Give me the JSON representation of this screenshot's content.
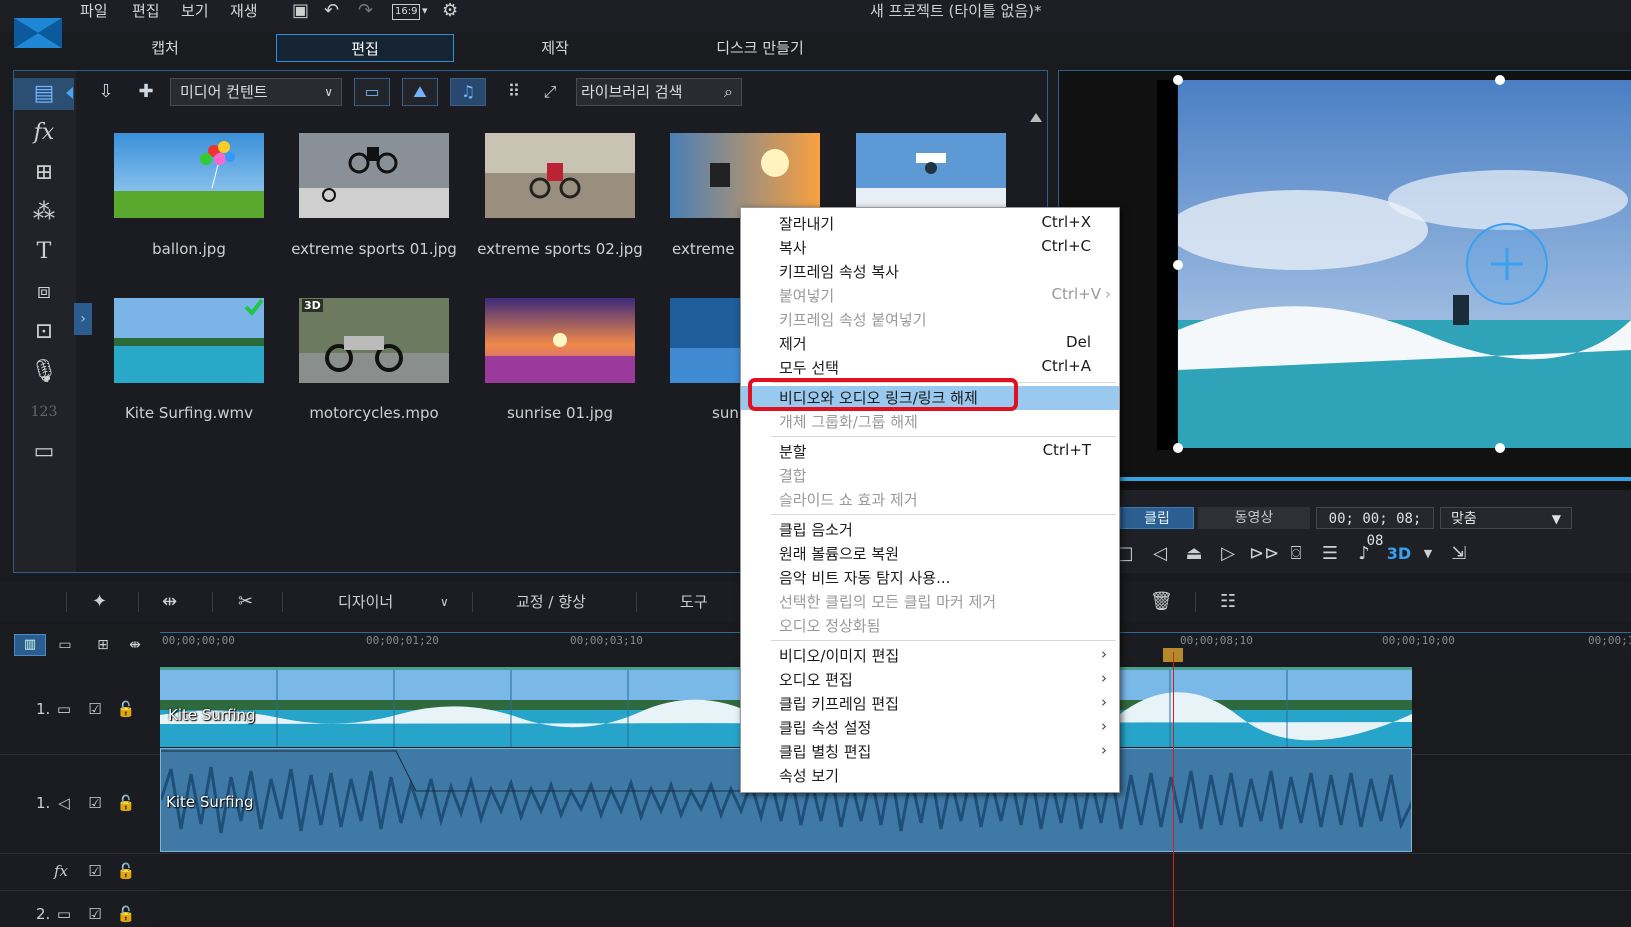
{
  "menubar": {
    "items": [
      "파일",
      "편집",
      "보기",
      "재생"
    ],
    "aspect": "16:9",
    "title": "새 프로젝트 (타이틀 없음)*"
  },
  "modes": [
    "캡처",
    "편집",
    "제작",
    "디스크 만들기"
  ],
  "library": {
    "media_select": "미디어 컨텐트",
    "search_placeholder": "라이브러리 검색",
    "items": [
      {
        "label": "ballon.jpg"
      },
      {
        "label": "extreme sports 01.jpg"
      },
      {
        "label": "extreme sports 02.jpg"
      },
      {
        "label": "extreme s"
      },
      {
        "label": "Kite Surfing.wmv"
      },
      {
        "label": "motorcycles.mpo",
        "badge": "3D"
      },
      {
        "label": "sunrise 01.jpg"
      },
      {
        "label": "sunr"
      }
    ]
  },
  "preview": {
    "clip_button": "클립",
    "movie_button": "동영상",
    "timecode": "00; 00; 08; 08",
    "fit": "맞춤",
    "badge_3d": "3D"
  },
  "edit_toolbar": {
    "designer": "디자이너",
    "fix": "교정 / 향상",
    "tools": "도구"
  },
  "timeline": {
    "ticks": [
      "00;00;00;00",
      "00;00;01;20",
      "00;00;03;10",
      "00;00;08;10",
      "00;00;10;00",
      "00;00;1"
    ],
    "tracks": [
      {
        "label": "1."
      },
      {
        "label": "1."
      },
      {
        "label": "fx"
      },
      {
        "label": "2."
      }
    ],
    "video_clip_name": "Kite Surfing",
    "audio_clip_name": "Kite Surfing"
  },
  "context_menu": {
    "items": [
      {
        "label": "잘라내기",
        "shortcut": "Ctrl+X"
      },
      {
        "label": "복사",
        "shortcut": "Ctrl+C"
      },
      {
        "label": "키프레임 속성 복사",
        "shortcut": ""
      },
      {
        "label": "붙여넣기",
        "shortcut": "Ctrl+V"
      },
      {
        "label": "키프레임 속성 붙여넣기",
        "shortcut": ""
      },
      {
        "label": "제거",
        "shortcut": "Del"
      },
      {
        "label": "모두 선택",
        "shortcut": "Ctrl+A"
      },
      {
        "label": "비디오와 오디오 링크/링크 해제",
        "shortcut": ""
      },
      {
        "label": "개체 그룹화/그룹 해제",
        "shortcut": ""
      },
      {
        "label": "분할",
        "shortcut": "Ctrl+T"
      },
      {
        "label": "결합",
        "shortcut": ""
      },
      {
        "label": "슬라이드 쇼 효과 제거",
        "shortcut": ""
      },
      {
        "label": "클립 음소거",
        "shortcut": ""
      },
      {
        "label": "원래 볼륨으로 복원",
        "shortcut": ""
      },
      {
        "label": "음악 비트 자동 탐지 사용...",
        "shortcut": ""
      },
      {
        "label": "선택한 클립의 모든 클립 마커 제거",
        "shortcut": ""
      },
      {
        "label": "오디오 정상화됨",
        "shortcut": ""
      },
      {
        "label": "비디오/이미지 편집",
        "shortcut": ""
      },
      {
        "label": "오디오 편집",
        "shortcut": ""
      },
      {
        "label": "클립 키프레임 편집",
        "shortcut": ""
      },
      {
        "label": "클립 속성 설정",
        "shortcut": ""
      },
      {
        "label": "클립 별칭 편집",
        "shortcut": ""
      },
      {
        "label": "속성 보기",
        "shortcut": ""
      }
    ]
  },
  "colors": {
    "accent": "#2f8fd8",
    "highlight": "#99c9ef",
    "callout": "#e01020"
  }
}
